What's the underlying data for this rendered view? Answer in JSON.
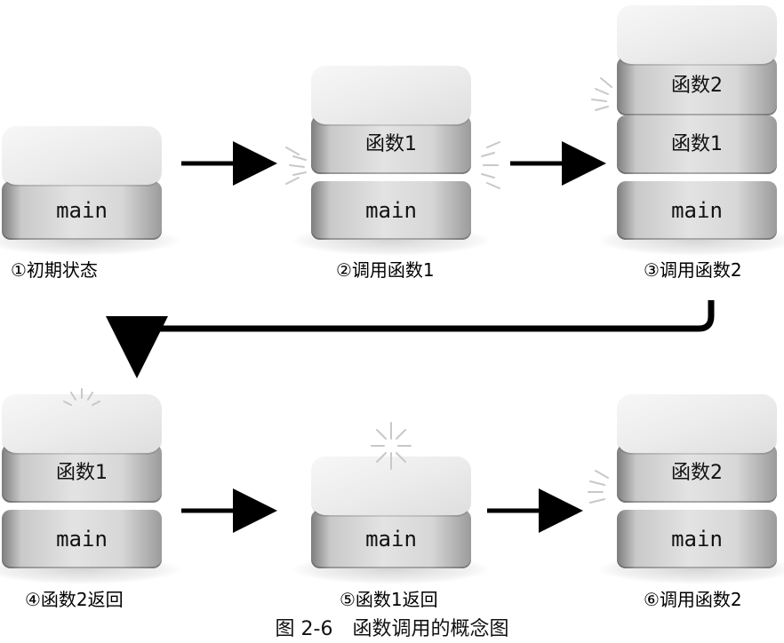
{
  "steps": [
    {
      "caption": "①初期状态",
      "blocks": [
        "main"
      ]
    },
    {
      "caption": "②调用函数1",
      "blocks": [
        "main",
        "函数1"
      ]
    },
    {
      "caption": "③调用函数2",
      "blocks": [
        "main",
        "函数1",
        "函数2"
      ]
    },
    {
      "caption": "④函数2返回",
      "blocks": [
        "main",
        "函数1"
      ]
    },
    {
      "caption": "⑤函数1返回",
      "blocks": [
        "main"
      ]
    },
    {
      "caption": "⑥调用函数2",
      "blocks": [
        "main",
        "函数2"
      ]
    }
  ],
  "title": "图 2-6　函数调用的概念图",
  "colors": {
    "arrow": "#000000",
    "block_top": "#f0f0f0",
    "block_side": "#cfcfcf",
    "burst": "#c8c8c8"
  }
}
